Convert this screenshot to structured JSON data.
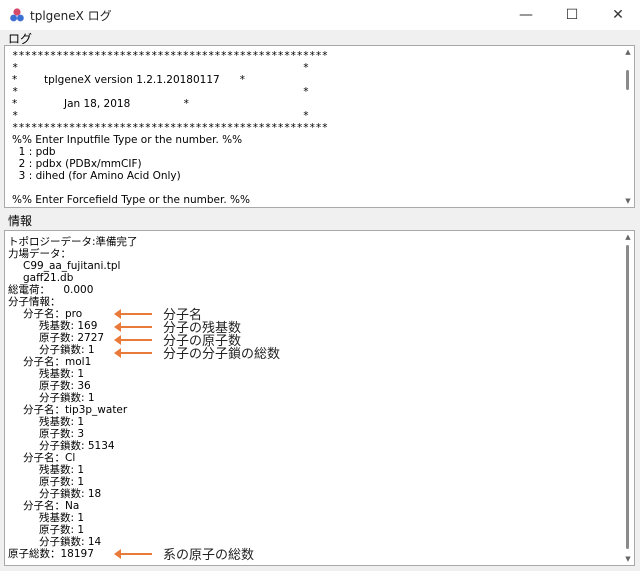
{
  "window": {
    "title": "tplgeneX ログ",
    "minimize": "—",
    "maximize": "☐",
    "close": "✕"
  },
  "log": {
    "label": "ログ",
    "lines": [
      "**************************************************",
      "*                                             *",
      "*        tplgeneX version 1.2.1.20180117      *",
      "*                                             *",
      "*              Jan 18, 2018                *",
      "*                                             *",
      "**************************************************",
      "%% Enter Inputfile Type or the number. %%",
      "  1 : pdb",
      "  2 : pdbx (PDBx/mmCIF)",
      "  3 : dihed (for Amino Acid Only)",
      "",
      "%% Enter Forcefield Type or the number. %%"
    ]
  },
  "info": {
    "label": "情報",
    "lines": [
      "トポロジーデータ:準備完了",
      "力場データ：",
      "C99_aa_fujitani.tpl",
      "gaff21.db",
      "総電荷：    0.000",
      "分子情報：",
      "分子名：pro",
      "残基数: 169",
      "原子数: 2727",
      "分子鎖数: 1",
      "分子名：mol1",
      "残基数: 1",
      "原子数: 36",
      "分子鎖数: 1",
      "分子名：tip3p_water",
      "残基数: 1",
      "原子数: 3",
      "分子鎖数: 5134",
      "分子名：Cl",
      "残基数: 1",
      "原子数: 1",
      "分子鎖数: 18",
      "分子名：Na",
      "残基数: 1",
      "原子数: 1",
      "分子鎖数: 14",
      "原子総数：18197"
    ]
  },
  "annotations": {
    "mol_name": "分子名",
    "residues": "分子の残基数",
    "atoms": "分子の原子数",
    "chains": "分子の分子鎖の総数",
    "total_atoms": "系の原子の総数",
    "arrow_color": "#ea7a3a"
  }
}
